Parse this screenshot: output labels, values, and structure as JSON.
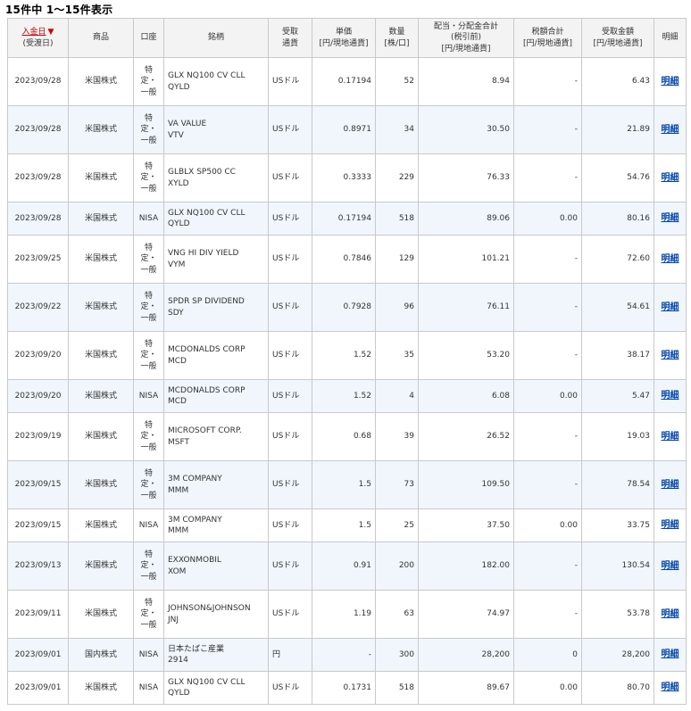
{
  "summary": "15件中 1～15件表示",
  "headers": {
    "date_main": "入金日",
    "date_sort_icon": "▼",
    "date_sub": "(受渡日)",
    "product": "商品",
    "account": "口座",
    "name": "銘柄",
    "currency_1": "受取",
    "currency_2": "通貨",
    "unit_price_1": "単価",
    "unit_price_2": "[円/現地通貨]",
    "qty_1": "数量",
    "qty_2": "[株/口]",
    "dividend_1": "配当・分配金合計",
    "dividend_2": "(税引前)",
    "dividend_3": "[円/現地通貨]",
    "tax_1": "税額合計",
    "tax_2": "[円/現地通貨]",
    "received_1": "受取金額",
    "received_2": "[円/現地通貨]",
    "detail": "明細"
  },
  "rows": [
    {
      "date": "2023/09/28",
      "product": "米国株式",
      "account": [
        "特",
        "定・",
        "一般"
      ],
      "name1": "GLX NQ100 CV CLL",
      "name2": "QYLD",
      "currency": "USドル",
      "price": "0.17194",
      "qty": "52",
      "dividend": "8.94",
      "tax": "-",
      "received": "6.43",
      "detail": "明細"
    },
    {
      "date": "2023/09/28",
      "product": "米国株式",
      "account": [
        "特",
        "定・",
        "一般"
      ],
      "name1": "VA VALUE",
      "name2": "VTV",
      "currency": "USドル",
      "price": "0.8971",
      "qty": "34",
      "dividend": "30.50",
      "tax": "-",
      "received": "21.89",
      "detail": "明細"
    },
    {
      "date": "2023/09/28",
      "product": "米国株式",
      "account": [
        "特",
        "定・",
        "一般"
      ],
      "name1": "GLBLX SP500 CC",
      "name2": "XYLD",
      "currency": "USドル",
      "price": "0.3333",
      "qty": "229",
      "dividend": "76.33",
      "tax": "-",
      "received": "54.76",
      "detail": "明細"
    },
    {
      "date": "2023/09/28",
      "product": "米国株式",
      "account": [
        "NISA"
      ],
      "name1": "GLX NQ100 CV CLL",
      "name2": "QYLD",
      "currency": "USドル",
      "price": "0.17194",
      "qty": "518",
      "dividend": "89.06",
      "tax": "0.00",
      "received": "80.16",
      "detail": "明細"
    },
    {
      "date": "2023/09/25",
      "product": "米国株式",
      "account": [
        "特",
        "定・",
        "一般"
      ],
      "name1": "VNG HI DIV YIELD",
      "name2": "VYM",
      "currency": "USドル",
      "price": "0.7846",
      "qty": "129",
      "dividend": "101.21",
      "tax": "-",
      "received": "72.60",
      "detail": "明細"
    },
    {
      "date": "2023/09/22",
      "product": "米国株式",
      "account": [
        "特",
        "定・",
        "一般"
      ],
      "name1": "SPDR SP DIVIDEND",
      "name2": "SDY",
      "currency": "USドル",
      "price": "0.7928",
      "qty": "96",
      "dividend": "76.11",
      "tax": "-",
      "received": "54.61",
      "detail": "明細"
    },
    {
      "date": "2023/09/20",
      "product": "米国株式",
      "account": [
        "特",
        "定・",
        "一般"
      ],
      "name1": "MCDONALDS CORP",
      "name2": "MCD",
      "currency": "USドル",
      "price": "1.52",
      "qty": "35",
      "dividend": "53.20",
      "tax": "-",
      "received": "38.17",
      "detail": "明細"
    },
    {
      "date": "2023/09/20",
      "product": "米国株式",
      "account": [
        "NISA"
      ],
      "name1": "MCDONALDS CORP",
      "name2": "MCD",
      "currency": "USドル",
      "price": "1.52",
      "qty": "4",
      "dividend": "6.08",
      "tax": "0.00",
      "received": "5.47",
      "detail": "明細"
    },
    {
      "date": "2023/09/19",
      "product": "米国株式",
      "account": [
        "特",
        "定・",
        "一般"
      ],
      "name1": "MICROSOFT CORP.",
      "name2": "MSFT",
      "currency": "USドル",
      "price": "0.68",
      "qty": "39",
      "dividend": "26.52",
      "tax": "-",
      "received": "19.03",
      "detail": "明細"
    },
    {
      "date": "2023/09/15",
      "product": "米国株式",
      "account": [
        "特",
        "定・",
        "一般"
      ],
      "name1": "3M COMPANY",
      "name2": "MMM",
      "currency": "USドル",
      "price": "1.5",
      "qty": "73",
      "dividend": "109.50",
      "tax": "-",
      "received": "78.54",
      "detail": "明細"
    },
    {
      "date": "2023/09/15",
      "product": "米国株式",
      "account": [
        "NISA"
      ],
      "name1": "3M COMPANY",
      "name2": "MMM",
      "currency": "USドル",
      "price": "1.5",
      "qty": "25",
      "dividend": "37.50",
      "tax": "0.00",
      "received": "33.75",
      "detail": "明細"
    },
    {
      "date": "2023/09/13",
      "product": "米国株式",
      "account": [
        "特",
        "定・",
        "一般"
      ],
      "name1": "EXXONMOBIL",
      "name2": "XOM",
      "currency": "USドル",
      "price": "0.91",
      "qty": "200",
      "dividend": "182.00",
      "tax": "-",
      "received": "130.54",
      "detail": "明細"
    },
    {
      "date": "2023/09/11",
      "product": "米国株式",
      "account": [
        "特",
        "定・",
        "一般"
      ],
      "name1": "JOHNSON&JOHNSON",
      "name2": "JNJ",
      "currency": "USドル",
      "price": "1.19",
      "qty": "63",
      "dividend": "74.97",
      "tax": "-",
      "received": "53.78",
      "detail": "明細"
    },
    {
      "date": "2023/09/01",
      "product": "国内株式",
      "account": [
        "NISA"
      ],
      "name1": "日本たばこ産業",
      "name2": "2914",
      "currency": "円",
      "price": "-",
      "qty": "300",
      "dividend": "28,200",
      "tax": "0",
      "received": "28,200",
      "detail": "明細"
    },
    {
      "date": "2023/09/01",
      "product": "米国株式",
      "account": [
        "NISA"
      ],
      "name1": "GLX NQ100 CV CLL",
      "name2": "QYLD",
      "currency": "USドル",
      "price": "0.1731",
      "qty": "518",
      "dividend": "89.67",
      "tax": "0.00",
      "received": "80.70",
      "detail": "明細"
    }
  ]
}
